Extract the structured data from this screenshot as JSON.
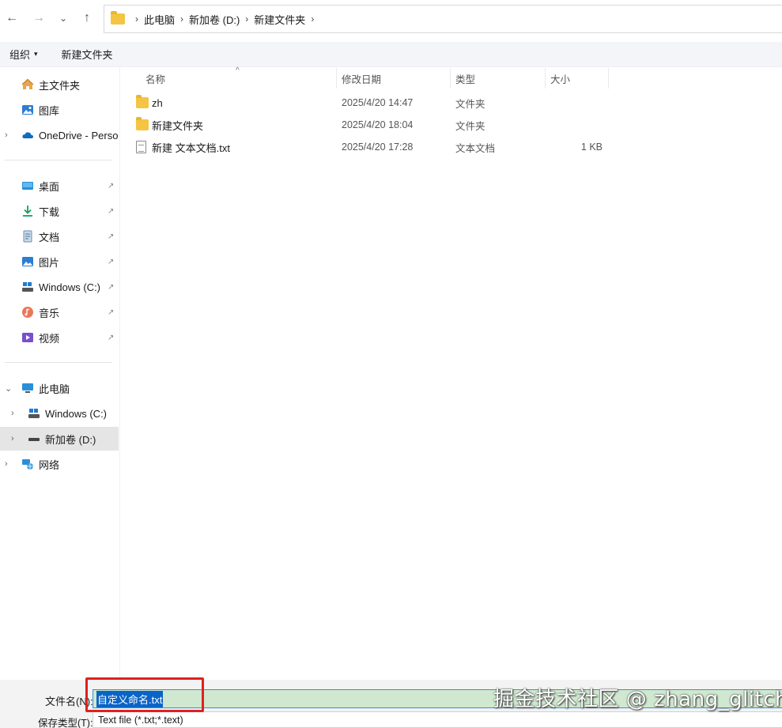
{
  "nav": {
    "back": "←",
    "forward": "→",
    "recent": "⌄",
    "up": "↑",
    "separator": "›",
    "breadcrumbs": [
      "此电脑",
      "新加卷 (D:)",
      "新建文件夹"
    ]
  },
  "toolbar": {
    "organize": "组织",
    "organize_caret": "▾",
    "new_folder": "新建文件夹"
  },
  "sidebar": {
    "quick": [
      {
        "label": "主文件夹",
        "icon": "home-icon"
      },
      {
        "label": "图库",
        "icon": "gallery-icon"
      },
      {
        "label": "OneDrive - Perso",
        "icon": "onedrive-cloud-icon",
        "expander": "›"
      }
    ],
    "pinned": [
      {
        "label": "桌面",
        "icon": "desktop-icon"
      },
      {
        "label": "下载",
        "icon": "download-icon"
      },
      {
        "label": "文档",
        "icon": "documents-icon"
      },
      {
        "label": "图片",
        "icon": "pictures-icon"
      },
      {
        "label": "Windows (C:)",
        "icon": "drive-icon"
      },
      {
        "label": "音乐",
        "icon": "music-icon"
      },
      {
        "label": "视频",
        "icon": "videos-icon"
      }
    ],
    "pin_glyph": "📌",
    "tree": [
      {
        "label": "此电脑",
        "icon": "this-pc-icon",
        "expander": "⌄"
      },
      {
        "label": "Windows (C:)",
        "icon": "drive-icon",
        "expander": "›"
      },
      {
        "label": "新加卷 (D:)",
        "icon": "drive-icon",
        "expander": "›",
        "selected": true
      },
      {
        "label": "网络",
        "icon": "network-icon",
        "expander": "›"
      }
    ]
  },
  "columns": {
    "name": "名称",
    "sort_caret": "^",
    "modified": "修改日期",
    "type": "类型",
    "size": "大小"
  },
  "files": [
    {
      "name": "zh",
      "modified": "2025/4/20 14:47",
      "type": "文件夹",
      "size": "",
      "icon": "folder-icon"
    },
    {
      "name": "新建文件夹",
      "modified": "2025/4/20 18:04",
      "type": "文件夹",
      "size": "",
      "icon": "folder-icon"
    },
    {
      "name": "新建 文本文档.txt",
      "modified": "2025/4/20 17:28",
      "type": "文本文档",
      "size": "1 KB",
      "icon": "text-file-icon"
    }
  ],
  "bottom": {
    "filename_label": "文件名(N):",
    "filename_value": "自定义命名.txt",
    "savetype_label": "保存类型(T):",
    "savetype_value": "Text file (*.txt;*.text)"
  },
  "watermark": "掘金技术社区 @ zhang_glitch",
  "colors": {
    "highlight_box": "#e02020",
    "selection": "#0a64c8",
    "folder": "#f4c542"
  }
}
